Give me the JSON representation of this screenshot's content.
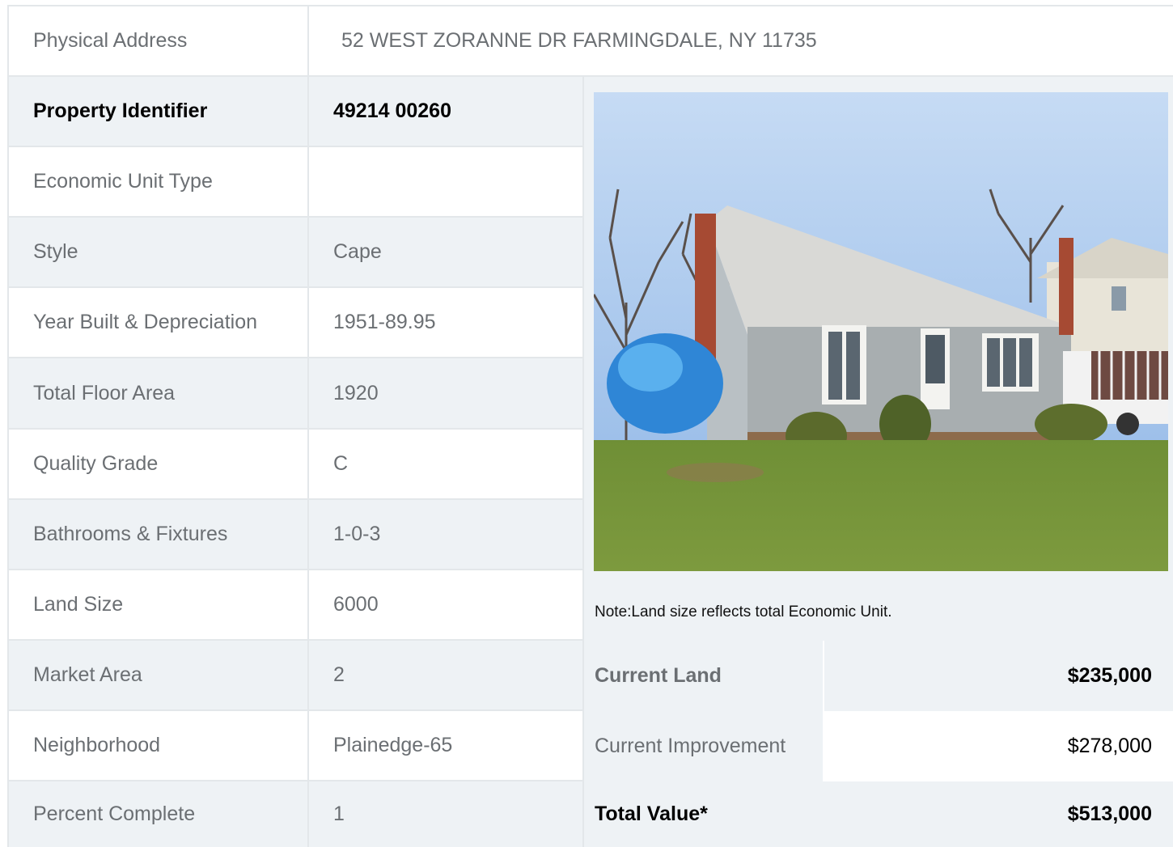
{
  "address": {
    "label": "Physical Address",
    "value": "52  WEST ZORANNE DR  FARMINGDALE, NY  11735"
  },
  "rows": [
    {
      "label": "Property Identifier",
      "value": "49214  00260",
      "bold": true
    },
    {
      "label": "Economic Unit Type",
      "value": ""
    },
    {
      "label": "Style",
      "value": "Cape"
    },
    {
      "label": "Year Built & Depreciation",
      "value": "1951-89.95"
    },
    {
      "label": "Total Floor Area",
      "value": "1920"
    },
    {
      "label": "Quality Grade",
      "value": "C"
    },
    {
      "label": "Bathrooms & Fixtures",
      "value": "1-0-3"
    },
    {
      "label": "Land Size",
      "value": "6000"
    },
    {
      "label": "Market Area",
      "value": "2"
    },
    {
      "label": "Neighborhood",
      "value": "Plainedge-65"
    },
    {
      "label": "Percent Complete",
      "value": "1"
    }
  ],
  "note": "Note:Land size reflects total Economic Unit.",
  "values": [
    {
      "label": "Current Land",
      "value": "$235,000",
      "bold": true
    },
    {
      "label": "Current Improvement",
      "value": "$278,000",
      "bold": false
    },
    {
      "label": "Total Value*",
      "value": "$513,000",
      "bold": true
    }
  ],
  "colors": {
    "row_gray": "#eef2f5",
    "border": "#e3e7ea",
    "text_muted": "#6b6f73"
  }
}
